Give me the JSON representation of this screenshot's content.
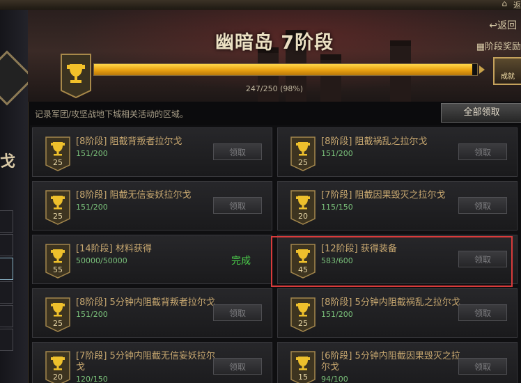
{
  "topbar": {
    "return_label": "返"
  },
  "header": {
    "title": "幽暗岛 7阶段",
    "back_label": "↩返回",
    "stage_reward_label": "阶段奖励",
    "progress": {
      "current": 247,
      "total": 250,
      "percent": 98,
      "text": "247/250 (98%)"
    },
    "achieve_label": "成就"
  },
  "description": "记录军团/攻坚战地下城相关活动的区域。",
  "claim_all_label": "全部领取",
  "cards": [
    {
      "points": "25",
      "name": "[8阶段] 阻截背叛者拉尔戈",
      "progress": "151/200",
      "status": "领取"
    },
    {
      "points": "25",
      "name": "[8阶段] 阻截祸乱之拉尔戈",
      "progress": "151/200",
      "status": "领取"
    },
    {
      "points": "25",
      "name": "[8阶段] 阻截无信妄妖拉尔戈",
      "progress": "151/200",
      "status": "领取"
    },
    {
      "points": "20",
      "name": "[7阶段] 阻截因果毁灭之拉尔戈",
      "progress": "115/150",
      "status": "领取"
    },
    {
      "points": "55",
      "name": "[14阶段] 材料获得",
      "progress": "50000/50000",
      "status": "完成"
    },
    {
      "points": "45",
      "name": "[12阶段] 获得装备",
      "progress": "583/600",
      "status": "领取"
    },
    {
      "points": "25",
      "name": "[8阶段] 5分钟内阻截背叛者拉尔戈",
      "progress": "151/200",
      "status": "领取"
    },
    {
      "points": "25",
      "name": "[8阶段] 5分钟内阻截祸乱之拉尔戈",
      "progress": "151/200",
      "status": "领取"
    },
    {
      "points": "20",
      "name": "[7阶段] 5分钟内阻截无信妄妖拉尔戈",
      "progress": "120/150",
      "status": "领取"
    },
    {
      "points": "15",
      "name": "[6阶段] 5分钟内阻截因果毁灭之拉尔戈",
      "progress": "94/100",
      "status": "领取"
    }
  ],
  "left_panel": {
    "char": "戈"
  },
  "colors": {
    "accent_gold": "#e8a010",
    "complete_green": "#4bd04b",
    "highlight_red": "#d83b3b"
  }
}
